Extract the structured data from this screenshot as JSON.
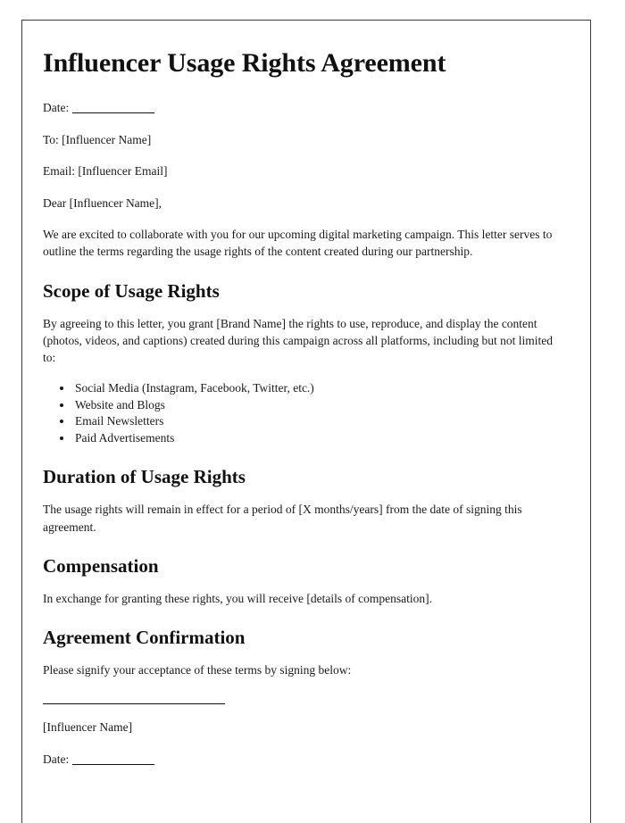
{
  "document": {
    "title": "Influencer Usage Rights Agreement",
    "header_fields": {
      "date_label": "Date:",
      "to_line": "To: [Influencer Name]",
      "email_line": "Email: [Influencer Email]",
      "salutation": "Dear [Influencer Name],"
    },
    "intro_paragraph": "We are excited to collaborate with you for our upcoming digital marketing campaign. This letter serves to outline the terms regarding the usage rights of the content created during our partnership.",
    "sections": [
      {
        "heading": "Scope of Usage Rights",
        "paragraph": "By agreeing to this letter, you grant [Brand Name] the rights to use, reproduce, and display the content (photos, videos, and captions) created during this campaign across all platforms, including but not limited to:",
        "bullets": [
          "Social Media (Instagram, Facebook, Twitter, etc.)",
          "Website and Blogs",
          "Email Newsletters",
          "Paid Advertisements"
        ]
      },
      {
        "heading": "Duration of Usage Rights",
        "paragraph": "The usage rights will remain in effect for a period of [X months/years] from the date of signing this agreement."
      },
      {
        "heading": "Compensation",
        "paragraph": "In exchange for granting these rights, you will receive [details of compensation]."
      },
      {
        "heading": "Agreement Confirmation",
        "paragraph": "Please signify your acceptance of these terms by signing below:"
      }
    ],
    "signature_block": {
      "name_placeholder": "[Influencer Name]",
      "date_label": "Date:"
    }
  }
}
